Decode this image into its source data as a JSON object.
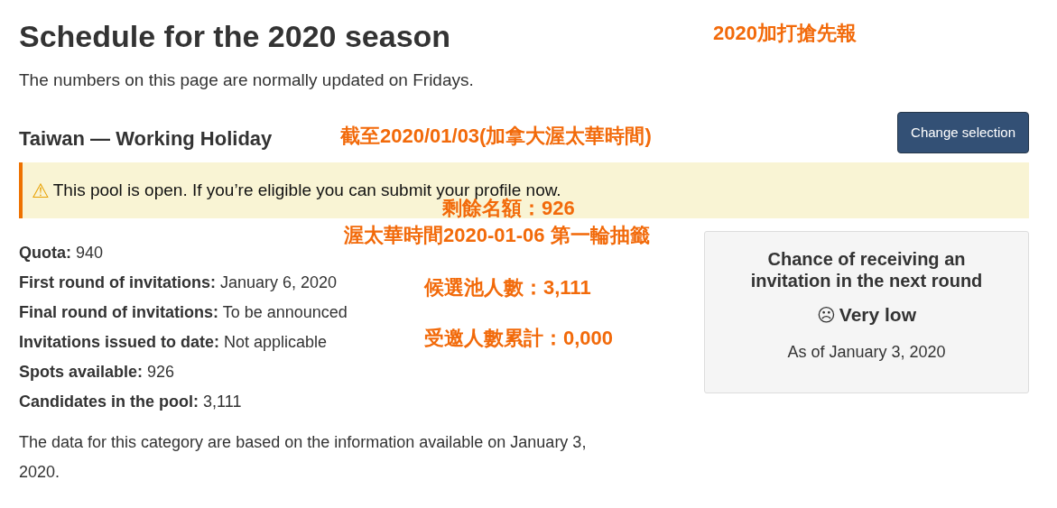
{
  "title": "Schedule for the 2020 season",
  "subtitle": "The numbers on this page are normally updated on Fridays.",
  "category": "Taiwan — Working Holiday",
  "change_button": "Change selection",
  "alert": {
    "icon": "⚠",
    "text": "This pool is open. If you’re eligible you can submit your profile now."
  },
  "facts": [
    {
      "label": "Quota:",
      "value": "940"
    },
    {
      "label": "First round of invitations:",
      "value": "January 6, 2020"
    },
    {
      "label": "Final round of invitations:",
      "value": "To be announced"
    },
    {
      "label": "Invitations issued to date:",
      "value": "Not applicable"
    },
    {
      "label": "Spots available:",
      "value": "926"
    },
    {
      "label": "Candidates in the pool:",
      "value": "3,111"
    }
  ],
  "note": "The data for this category are based on the information available on January 3, 2020.",
  "chance_card": {
    "title": "Chance of receiving an invitation in the next round",
    "face": "☹",
    "rating": "Very low",
    "as_of": "As of January 3, 2020"
  },
  "annotations": [
    "2020加打搶先報",
    "截至2020/01/03(加拿大渥太華時間)",
    "剩餘名額：926",
    "渥太華時間2020-01-06 第一輪抽籤",
    "候選池人數：3,111",
    "受邀人數累計：0,000"
  ]
}
